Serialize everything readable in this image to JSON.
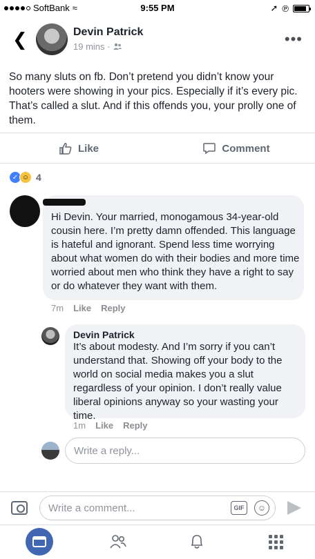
{
  "status_bar": {
    "carrier": "SoftBank",
    "time": "9:55 PM",
    "battery_level": 0.85
  },
  "post": {
    "author": "Devin Patrick",
    "meta": "19 mins ·",
    "audience_icon": "friends-icon",
    "text": "So many sluts on fb. Don’t pretend you didn’t know your hooters were showing in your pics. Especially if it’s every pic. That’s called a slut. And if this offends you, your prolly one of them.",
    "like_label": "Like",
    "comment_label": "Comment",
    "reaction_count": "4"
  },
  "comments": [
    {
      "text": "Hi Devin. Your married, monogamous 34-year-old cousin here. I’m pretty damn offended. This language is hateful and ignorant. Spend less time worrying about what women do with their bodies and more time worried about men who think they have a right to say or do whatever they want with them.",
      "time": "7m",
      "like_label": "Like",
      "reply_label": "Reply"
    }
  ],
  "reply": {
    "author": "Devin Patrick",
    "text": "It’s about modesty. And I’m sorry if you can’t understand that. Showing off your body to the world on social media makes you a slut regardless of your opinion. I don’t really value liberal opinions anyway so your wasting your time.",
    "time": "1m",
    "like_label": "Like",
    "reply_label": "Reply"
  },
  "reply_input": {
    "placeholder": "Write a reply..."
  },
  "composer": {
    "placeholder": "Write a comment...",
    "gif_label": "GIF"
  },
  "colors": {
    "brand": "#4267b2",
    "bubble": "#f1f2f6",
    "muted": "#90949c"
  }
}
